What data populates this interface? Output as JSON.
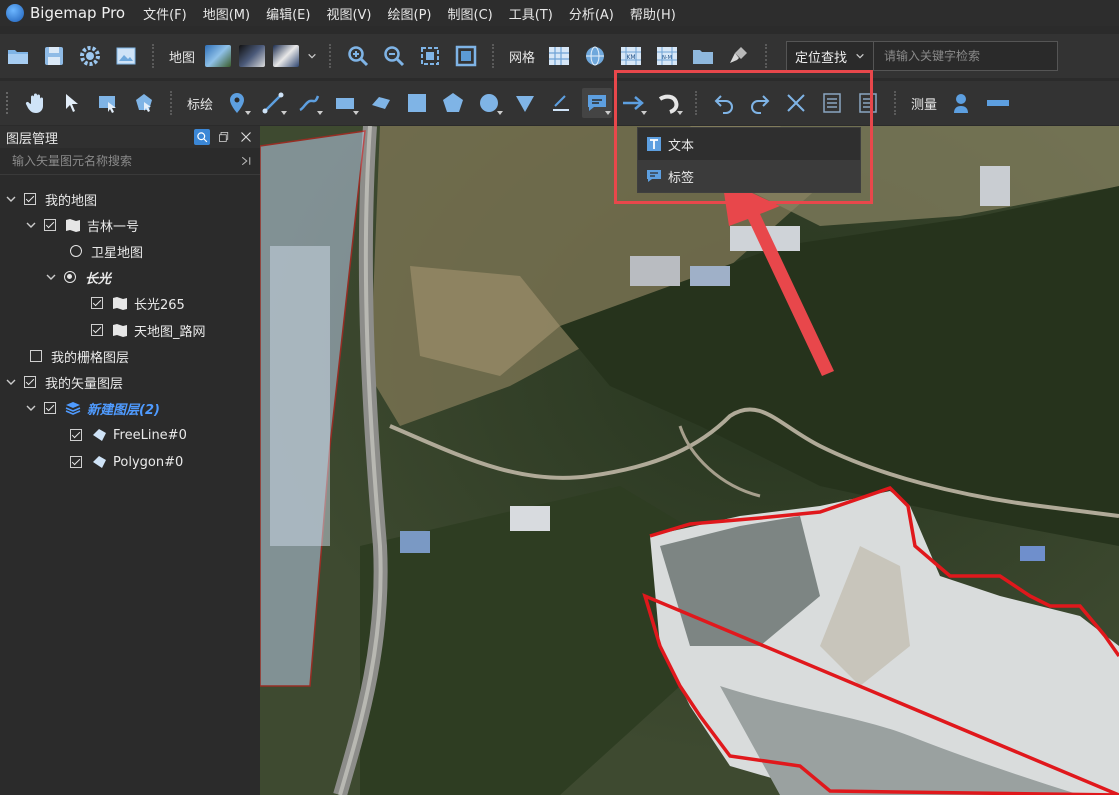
{
  "app": {
    "title": "Bigemap Pro"
  },
  "menu": [
    "文件(F)",
    "地图(M)",
    "编辑(E)",
    "视图(V)",
    "绘图(P)",
    "制图(C)",
    "工具(T)",
    "分析(A)",
    "帮助(H)"
  ],
  "toolbar1": {
    "map_label": "地图",
    "grid_label": "网格",
    "locate_select": "定位查找",
    "search_placeholder": "请输入关键字检索"
  },
  "toolbar2": {
    "annotate_label": "标绘",
    "measure_label": "测量"
  },
  "dropdown": {
    "items": [
      "文本",
      "标签"
    ]
  },
  "layer_panel": {
    "title": "图层管理",
    "search_placeholder": "输入矢量图元名称搜索",
    "items": [
      {
        "label": "我的地图"
      },
      {
        "label": "吉林一号"
      },
      {
        "label": "卫星地图"
      },
      {
        "label": "长光"
      },
      {
        "label": "长光265"
      },
      {
        "label": "天地图_路网"
      },
      {
        "label": "我的栅格图层"
      },
      {
        "label": "我的矢量图层"
      },
      {
        "label": "新建图层(2)"
      },
      {
        "label": "FreeLine#0"
      },
      {
        "label": "Polygon#0"
      }
    ]
  },
  "colors": {
    "accent_blue": "#4f9bff",
    "highlight_red": "#e8474b",
    "boundary_red": "#e0181c"
  }
}
